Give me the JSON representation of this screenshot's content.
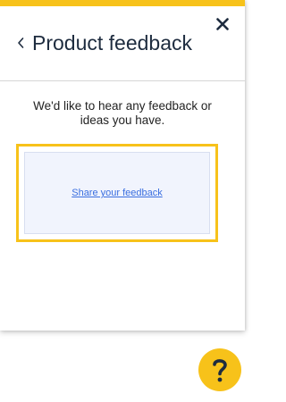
{
  "panel": {
    "title": "Product feedback",
    "intro": "We'd like to hear any feedback or ideas you have.",
    "share_link": "Share your feedback"
  },
  "icons": {
    "close": "close-icon",
    "back": "chevron-left-icon",
    "help": "question-mark-icon"
  },
  "colors": {
    "accent": "#f7c21a",
    "title": "#1e2c3f",
    "link": "#3a6ee0",
    "inner_bg": "#f1f4fd"
  }
}
